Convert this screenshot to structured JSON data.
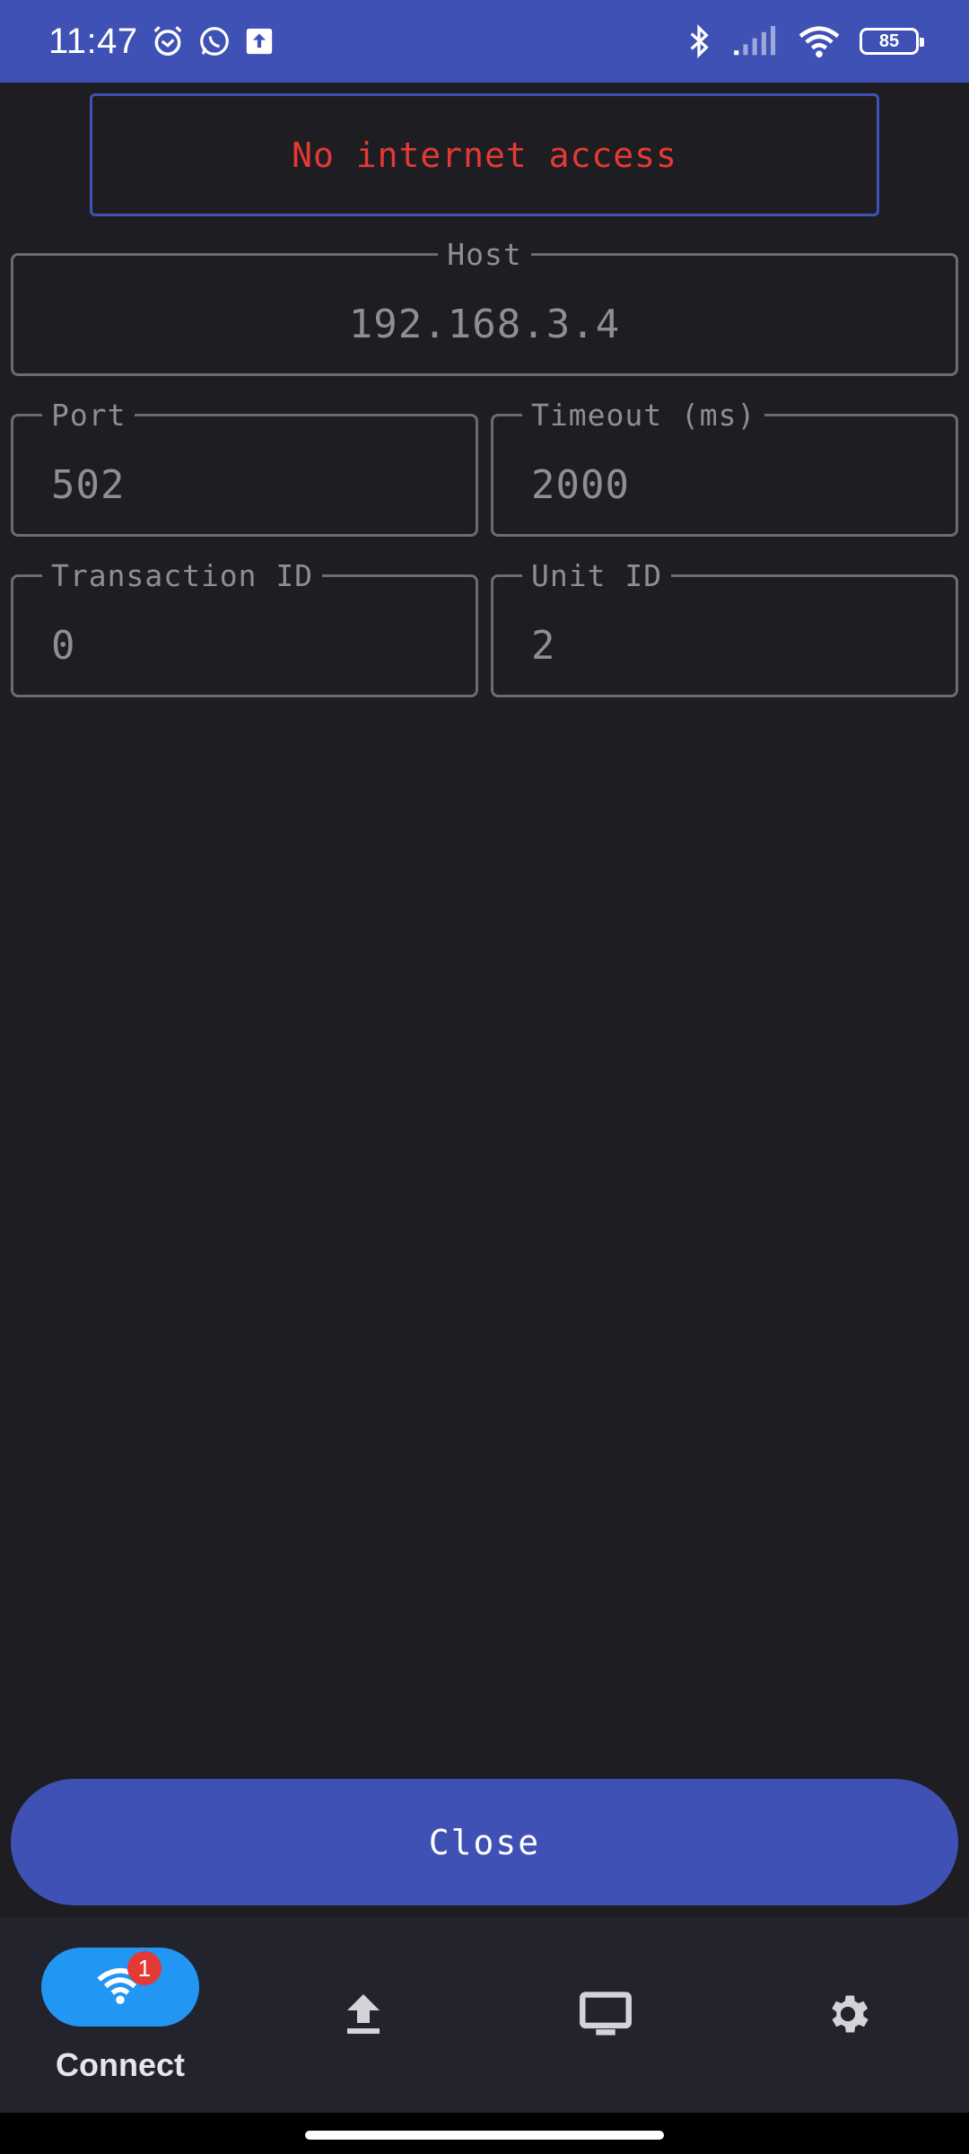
{
  "status_bar": {
    "time": "11:47",
    "battery_level": "85",
    "left_icons": [
      "alarm-icon",
      "whatsapp-icon",
      "upload-notification-icon"
    ],
    "right_icons": [
      "bluetooth-icon",
      "signal-icon",
      "wifi-icon",
      "battery-icon"
    ]
  },
  "banner": {
    "text": "No internet access",
    "color": "#e53935"
  },
  "fields": {
    "host": {
      "label": "Host",
      "value": "192.168.3.4"
    },
    "port": {
      "label": "Port",
      "value": "502"
    },
    "timeout": {
      "label": "Timeout (ms)",
      "value": "2000"
    },
    "transaction_id": {
      "label": "Transaction ID",
      "value": "0"
    },
    "unit_id": {
      "label": "Unit ID",
      "value": "2"
    }
  },
  "close_button": {
    "label": "Close"
  },
  "bottom_nav": {
    "items": [
      {
        "label": "Connect",
        "icon": "wifi-icon",
        "badge": "1",
        "active": true
      },
      {
        "label": "",
        "icon": "upload-icon",
        "active": false
      },
      {
        "label": "",
        "icon": "monitor-icon",
        "active": false
      },
      {
        "label": "",
        "icon": "gear-icon",
        "active": false
      }
    ]
  },
  "colors": {
    "primary": "#3f51b5",
    "active_nav": "#2196f3",
    "background": "#1e1e22",
    "error": "#e53935"
  }
}
